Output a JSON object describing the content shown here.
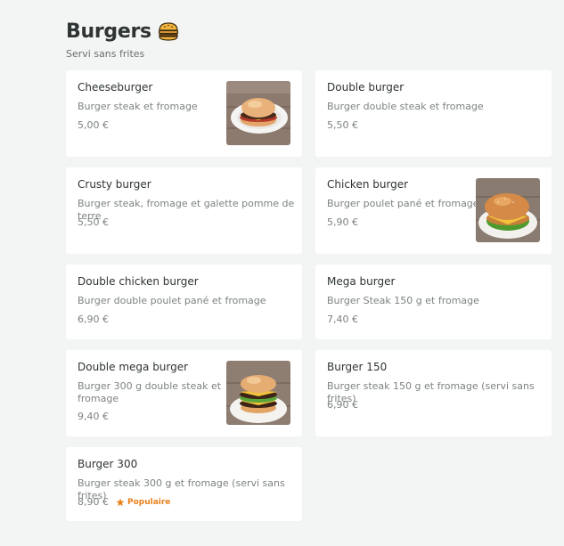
{
  "section": {
    "title": "Burgers",
    "emoji_icon": "burger-icon",
    "subtitle": "Servi sans frites"
  },
  "items": [
    {
      "name": "Cheeseburger",
      "description": "Burger steak et fromage",
      "price": "5,00 €",
      "has_image": true,
      "image_icon": "cheeseburger-photo"
    },
    {
      "name": "Double burger",
      "description": "Burger double steak et fromage",
      "price": "5,50 €",
      "has_image": false
    },
    {
      "name": "Crusty burger",
      "description": "Burger steak, fromage et galette pomme de terre",
      "price": "5,50 €",
      "has_image": false
    },
    {
      "name": "Chicken burger",
      "description": "Burger poulet pané et fromage",
      "price": "5,90 €",
      "has_image": true,
      "image_icon": "chicken-burger-photo"
    },
    {
      "name": "Double chicken burger",
      "description": "Burger double poulet pané et fromage",
      "price": "6,90 €",
      "has_image": false
    },
    {
      "name": "Mega burger",
      "description": "Burger Steak 150 g et fromage",
      "price": "7,40 €",
      "has_image": false
    },
    {
      "name": "Double mega burger",
      "description_line1": "Burger 300 g double steak et",
      "description_line2": "fromage",
      "price": "9,40 €",
      "has_image": true,
      "image_icon": "double-mega-burger-photo"
    },
    {
      "name": "Burger 150",
      "description": "Burger steak 150 g et fromage (servi sans frites)",
      "price": "6,90 €",
      "has_image": false
    },
    {
      "name": "Burger 300",
      "description": "Burger steak 300 g et fromage (servi sans frites)",
      "price": "8,90 €",
      "has_image": false,
      "badge": "Populaire",
      "badge_icon": "star-icon"
    }
  ],
  "colors": {
    "background": "#f3f4f4",
    "card": "#ffffff",
    "text": "#2e3333",
    "muted": "#7d8282",
    "popular": "#e8801a"
  }
}
